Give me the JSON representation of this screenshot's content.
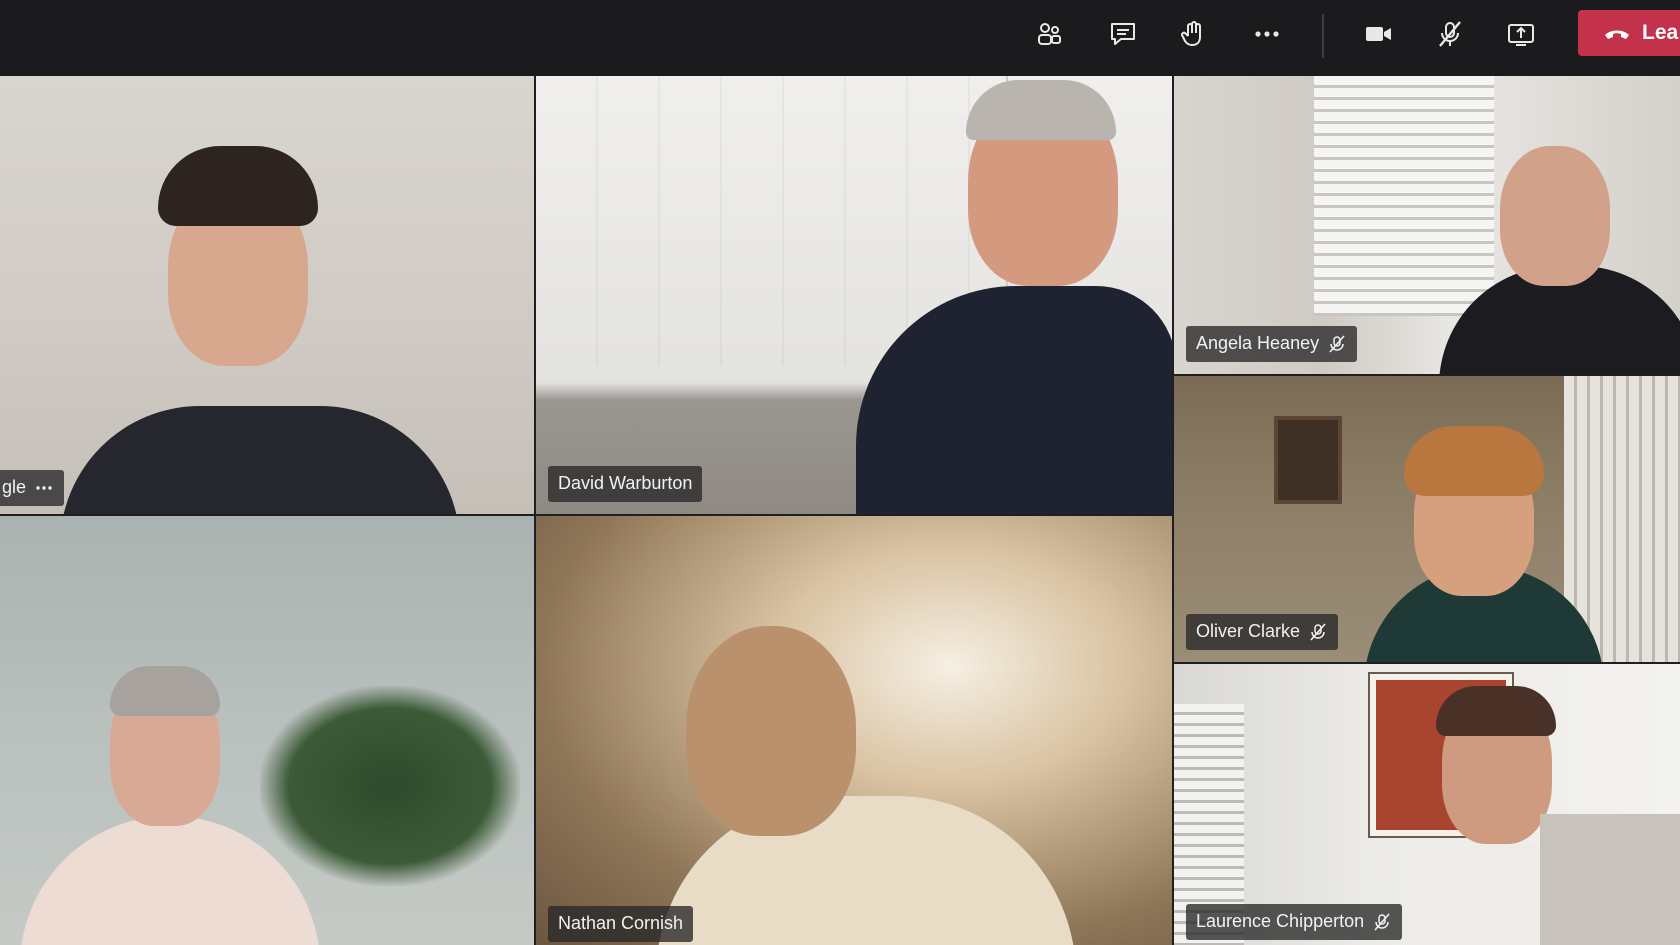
{
  "toolbar": {
    "buttons": [
      {
        "icon": "people-icon",
        "label": "Participants"
      },
      {
        "icon": "chat-icon",
        "label": "Chat"
      },
      {
        "icon": "raise-hand-icon",
        "label": "Raise hand"
      },
      {
        "icon": "more-options-icon",
        "label": "More actions"
      },
      {
        "icon": "camera-icon",
        "label": "Camera"
      },
      {
        "icon": "mic-off-icon",
        "label": "Mute"
      },
      {
        "icon": "share-screen-icon",
        "label": "Share"
      }
    ],
    "leave_label": "Lea",
    "leave_color": "#c4314b"
  },
  "participants": [
    {
      "name": "gle",
      "tile": "top-left",
      "muted": false,
      "has_more": true
    },
    {
      "name": "David Warburton",
      "tile": "top-center",
      "muted": false
    },
    {
      "name": "Angela Heaney",
      "tile": "top-right",
      "muted": true
    },
    {
      "name": "Oliver Clarke",
      "tile": "mid-right",
      "muted": true
    },
    {
      "name": "Nathan Cornish",
      "tile": "bottom-center",
      "muted": false
    },
    {
      "name": "Laurence Chipperton",
      "tile": "bottom-right",
      "muted": true
    },
    {
      "name": "",
      "tile": "bottom-left",
      "muted": false
    }
  ]
}
